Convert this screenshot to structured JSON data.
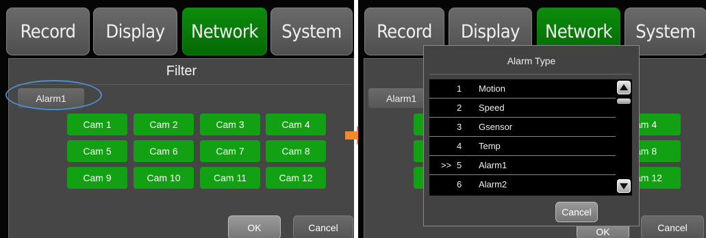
{
  "tabs": [
    {
      "label": "Record"
    },
    {
      "label": "Display"
    },
    {
      "label": "Network"
    },
    {
      "label": "System"
    }
  ],
  "active_tab": "Network",
  "filter": {
    "title": "Filter",
    "alarm_button": "Alarm1",
    "cams": [
      "Cam 1",
      "Cam 2",
      "Cam 3",
      "Cam 4",
      "Cam 5",
      "Cam 6",
      "Cam 7",
      "Cam 8",
      "Cam 9",
      "Cam 10",
      "Cam 11",
      "Cam 12"
    ],
    "ok_label": "OK",
    "cancel_label": "Cancel"
  },
  "right_background": {
    "alarm_button": "Alarm1",
    "cams_visible": [
      "am 4",
      "am 8",
      "am 12"
    ],
    "ok_partial": "OK",
    "cancel_label": "Cancel"
  },
  "alarm_type_dialog": {
    "title": "Alarm Type",
    "items": [
      {
        "marker": "",
        "num": "1",
        "name": "Motion"
      },
      {
        "marker": "",
        "num": "2",
        "name": "Speed"
      },
      {
        "marker": "",
        "num": "3",
        "name": "Gsensor"
      },
      {
        "marker": "",
        "num": "4",
        "name": "Temp"
      },
      {
        "marker": ">>",
        "num": "5",
        "name": "Alarm1"
      },
      {
        "marker": "",
        "num": "6",
        "name": "Alarm2"
      }
    ],
    "cancel_label": "Cancel"
  },
  "colors": {
    "active_tab": "#0a7a0a",
    "cam_button": "#12a112",
    "highlight_ellipse": "#4b8ed4",
    "transition_arrow": "#f08a2a"
  }
}
